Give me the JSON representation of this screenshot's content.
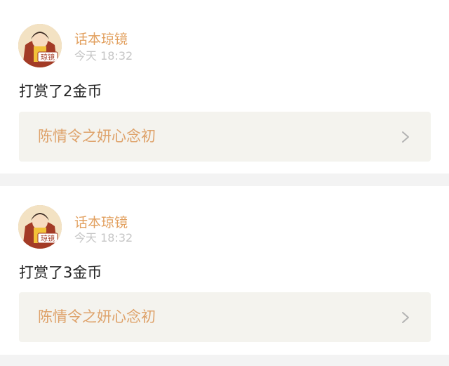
{
  "notifications": [
    {
      "username": "话本琼镜",
      "timestamp": "今天 18:32",
      "message": "打赏了2金币",
      "link_title": "陈情令之妍心念初",
      "avatar_badge": "琼镜"
    },
    {
      "username": "话本琼镜",
      "timestamp": "今天 18:32",
      "message": "打赏了3金币",
      "link_title": "陈情令之妍心念初",
      "avatar_badge": "琼镜"
    }
  ],
  "colors": {
    "username": "#e2a05f",
    "link_title": "#dea26a",
    "timestamp": "#c6c6c6",
    "link_bg": "#f4f3ee",
    "page_bg": "#f3f3f3"
  },
  "icons": {
    "link_arrow": "chevron-right-icon"
  }
}
